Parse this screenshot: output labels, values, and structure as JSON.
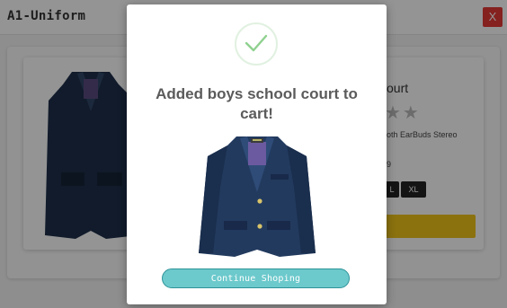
{
  "background_page": {
    "brand": "A1-Uniform",
    "close_label": "X",
    "product": {
      "name_fragment": "ourt",
      "stars": "★★",
      "description_fragment": "oth EarBuds Stereo",
      "price_fragment": "9",
      "sizes": [
        "L",
        "XL"
      ]
    }
  },
  "modal": {
    "title": "Added boys school court to cart!",
    "continue_label": "Continue Shoping",
    "icon": "check-icon",
    "accent_color": "#6cc9cc"
  }
}
